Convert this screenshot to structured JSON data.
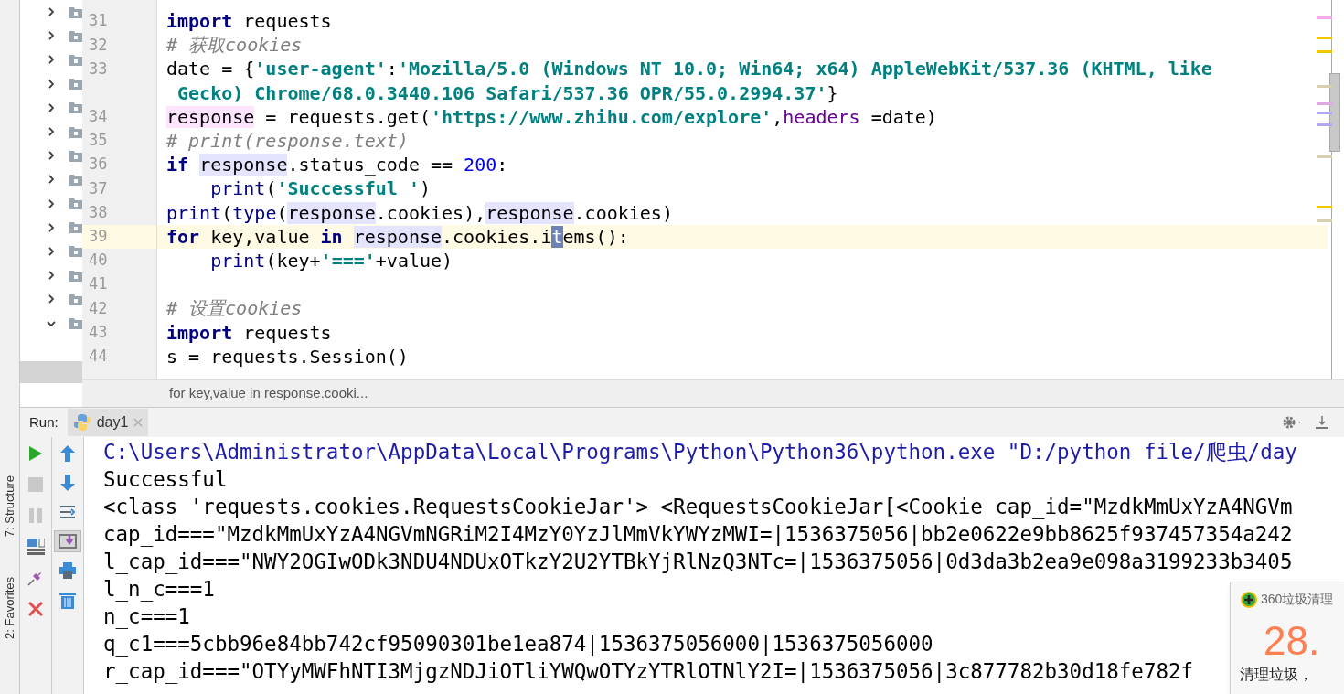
{
  "side_tabs": [
    {
      "label": "7: Structure"
    },
    {
      "label": "2: Favorites"
    }
  ],
  "tree_rows": [
    {
      "expanded": false
    },
    {
      "expanded": false
    },
    {
      "expanded": false
    },
    {
      "expanded": false
    },
    {
      "expanded": false
    },
    {
      "expanded": false
    },
    {
      "expanded": false
    },
    {
      "expanded": false
    },
    {
      "expanded": false
    },
    {
      "expanded": false
    },
    {
      "expanded": false
    },
    {
      "expanded": false
    },
    {
      "expanded": false
    },
    {
      "expanded": true
    }
  ],
  "editor": {
    "lines": [
      {
        "number": "31",
        "current": false,
        "tokens": [
          {
            "t": "import",
            "kind": "kw"
          },
          {
            "t": " requests",
            "kind": "plain"
          }
        ]
      },
      {
        "number": "32",
        "current": false,
        "tokens": [
          {
            "t": "# 获取cookies",
            "kind": "comment"
          }
        ]
      },
      {
        "number": "33",
        "current": false,
        "tokens": [
          {
            "t": "date = {",
            "kind": "plain"
          },
          {
            "t": "'user-agent'",
            "kind": "str"
          },
          {
            "t": ":",
            "kind": "plain"
          },
          {
            "t": "'Mozilla/5.0 (Windows NT 10.0; Win64; x64) AppleWebKit/537.36 (KHTML, like",
            "kind": "str"
          }
        ]
      },
      {
        "current": false,
        "tokens": [
          {
            "t": " Gecko) Chrome/68.0.3440.106 Safari/537.36 OPR/55.0.2994.37'",
            "kind": "str"
          },
          {
            "t": "}",
            "kind": "plain"
          }
        ]
      },
      {
        "number": "34",
        "current": false,
        "tokens": [
          {
            "t": "response",
            "kind": "write"
          },
          {
            "t": " = requests.get(",
            "kind": "plain"
          },
          {
            "t": "'https://www.zhihu.com/explore'",
            "kind": "str"
          },
          {
            "t": ",",
            "kind": "plain"
          },
          {
            "t": "headers",
            "kind": "param"
          },
          {
            "t": " =date)",
            "kind": "plain"
          }
        ]
      },
      {
        "number": "35",
        "current": false,
        "tokens": [
          {
            "t": "# print(response.text)",
            "kind": "comment"
          }
        ]
      },
      {
        "number": "36",
        "current": false,
        "tokens": [
          {
            "t": "if ",
            "kind": "kw"
          },
          {
            "t": "response",
            "kind": "ref"
          },
          {
            "t": ".status_code == ",
            "kind": "plain"
          },
          {
            "t": "200",
            "kind": "num"
          },
          {
            "t": ":",
            "kind": "plain"
          }
        ]
      },
      {
        "number": "37",
        "current": false,
        "tokens": [
          {
            "t": "    print",
            "kind": "builtin"
          },
          {
            "t": "(",
            "kind": "plain"
          },
          {
            "t": "'Successful '",
            "kind": "str"
          },
          {
            "t": ")",
            "kind": "plain"
          }
        ]
      },
      {
        "number": "38",
        "current": false,
        "tokens": [
          {
            "t": "print",
            "kind": "builtin"
          },
          {
            "t": "(",
            "kind": "plain"
          },
          {
            "t": "type",
            "kind": "builtin"
          },
          {
            "t": "(",
            "kind": "plain"
          },
          {
            "t": "response",
            "kind": "ref"
          },
          {
            "t": ".cookies),",
            "kind": "plain"
          },
          {
            "t": "response",
            "kind": "ref"
          },
          {
            "t": ".cookies)",
            "kind": "plain"
          }
        ]
      },
      {
        "number": "39",
        "current": true,
        "tokens": [
          {
            "t": "for",
            "kind": "kw"
          },
          {
            "t": " key,value ",
            "kind": "plain"
          },
          {
            "t": "in ",
            "kind": "kw"
          },
          {
            "t": "response",
            "kind": "ref"
          },
          {
            "t": ".cookies.i",
            "kind": "plain"
          },
          {
            "t": "t",
            "kind": "caret"
          },
          {
            "t": "ems():",
            "kind": "plain"
          }
        ]
      },
      {
        "number": "40",
        "current": false,
        "tokens": [
          {
            "t": "    print",
            "kind": "builtin"
          },
          {
            "t": "(key+",
            "kind": "plain"
          },
          {
            "t": "'==='",
            "kind": "str"
          },
          {
            "t": "+value)",
            "kind": "plain"
          }
        ]
      },
      {
        "number": "41",
        "current": false
      },
      {
        "number": "42",
        "current": false,
        "tokens": [
          {
            "t": "# 设置cookies",
            "kind": "comment"
          }
        ]
      },
      {
        "number": "43",
        "current": false,
        "tokens": [
          {
            "t": "import",
            "kind": "kw"
          },
          {
            "t": " requests",
            "kind": "plain"
          }
        ]
      },
      {
        "number": "44",
        "current": false,
        "tokens": [
          {
            "t": "s = requests.Session()",
            "kind": "plain"
          }
        ]
      }
    ],
    "hint": "for key,value in response.cooki..."
  },
  "run_panel": {
    "label": "Run:",
    "tab": {
      "title": "day1",
      "selected": true
    },
    "left_tools": [
      {
        "disabled": false
      },
      {
        "disabled": true
      },
      {
        "disabled": true
      },
      {
        "disabled": false
      },
      {
        "disabled": false
      },
      {
        "disabled": false
      }
    ],
    "right_tools": [
      {
        "selected": false
      },
      {
        "selected": false
      },
      {
        "selected": false
      },
      {
        "selected": true
      },
      {
        "selected": false
      },
      {
        "selected": false
      }
    ],
    "console": [
      {
        "kind": "command",
        "text": "C:\\Users\\Administrator\\AppData\\Local\\Programs\\Python\\Python36\\python.exe \"D:/python file/爬虫/day"
      },
      {
        "kind": "output",
        "text": "Successful"
      },
      {
        "kind": "output",
        "text": "<class 'requests.cookies.RequestsCookieJar'> <RequestsCookieJar[<Cookie cap_id=\"MzdkMmUxYzA4NGVm"
      },
      {
        "kind": "output",
        "text": "cap_id===\"MzdkMmUxYzA4NGVmNGRiM2I4MzY0YzJlMmVkYWYzMWI=|1536375056|bb2e0622e9bb8625f937457354a242"
      },
      {
        "kind": "output",
        "text": "l_cap_id===\"NWY2OGIwODk3NDU4NDUxOTkzY2U2YTBkYjRlNzQ3NTc=|1536375056|0d3da3b2ea9e098a3199233b3405"
      },
      {
        "kind": "output",
        "text": "l_n_c===1"
      },
      {
        "kind": "output",
        "text": "n_c===1"
      },
      {
        "kind": "output",
        "text": "q_c1===5cbb96e84bb742cf95090301be1ea874|1536375056000|1536375056000"
      },
      {
        "kind": "output",
        "text": "r_cap_id===\"OTYyMWFhNTI3MjgzNDJiOTliYWQwOTYzYTRlOTNlY2I=|1536375056|3c877782b30d18fe782f"
      }
    ]
  },
  "popup": {
    "title": "360垃圾清理",
    "value": "28.",
    "caption": "清理垃圾，"
  }
}
